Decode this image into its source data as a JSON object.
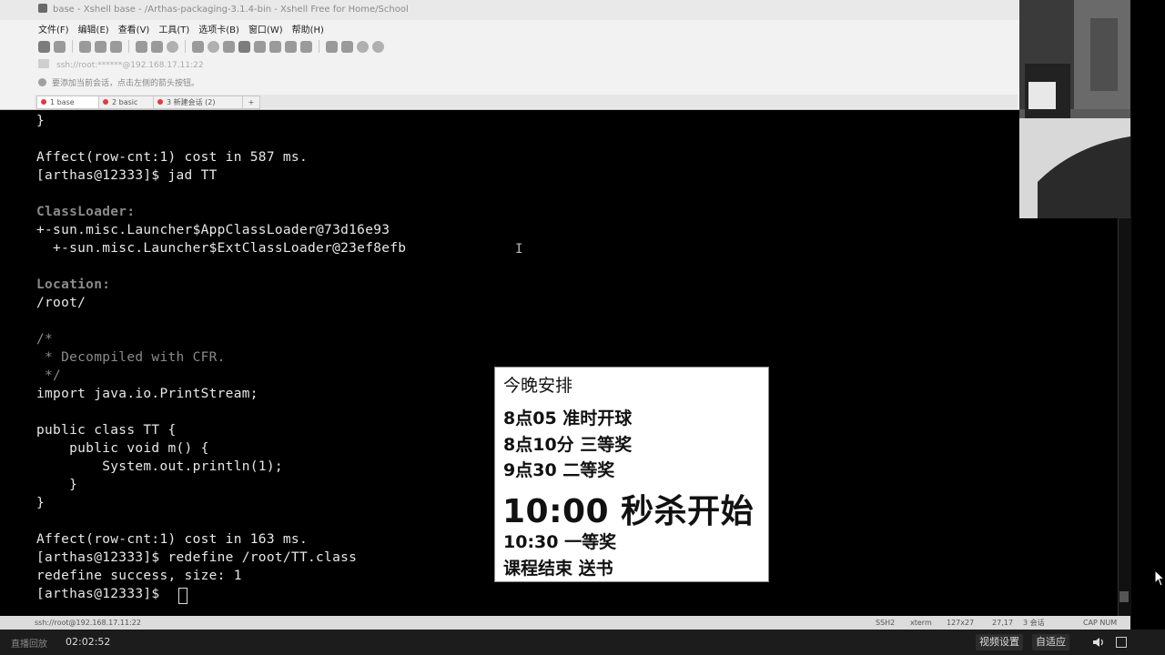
{
  "window": {
    "title": "base - Xshell base - /Arthas-packaging-3.1.4-bin - Xshell Free for Home/School",
    "menu": [
      "文件(F)",
      "编辑(E)",
      "查看(V)",
      "工具(T)",
      "选项卡(B)",
      "窗口(W)",
      "帮助(H)"
    ],
    "address": "ssh://root:******@192.168.17.11:22",
    "tip": "要添加当前会话，点击左侧的箭头按钮。",
    "tabs": [
      "1 base",
      "2 basic",
      "3 新建会话 (2)"
    ],
    "tab_add": "+"
  },
  "terminal": {
    "lines": [
      {
        "text": "}",
        "style": "normal"
      },
      {
        "text": "",
        "style": "normal"
      },
      {
        "text": "Affect(row-cnt:1) cost in 587 ms.",
        "style": "normal"
      },
      {
        "text": "[arthas@12333]$ jad TT",
        "style": "normal"
      },
      {
        "text": "",
        "style": "normal"
      },
      {
        "text": "ClassLoader:",
        "style": "hdr"
      },
      {
        "text": "+-sun.misc.Launcher$AppClassLoader@73d16e93",
        "style": "normal"
      },
      {
        "text": "  +-sun.misc.Launcher$ExtClassLoader@23ef8efb",
        "style": "normal"
      },
      {
        "text": "",
        "style": "normal"
      },
      {
        "text": "Location:",
        "style": "hdr"
      },
      {
        "text": "/root/",
        "style": "normal"
      },
      {
        "text": "",
        "style": "normal"
      },
      {
        "text": "/*",
        "style": "cmt"
      },
      {
        "text": " * Decompiled with CFR.",
        "style": "cmt"
      },
      {
        "text": " */",
        "style": "cmt"
      },
      {
        "text": "import java.io.PrintStream;",
        "style": "normal"
      },
      {
        "text": "",
        "style": "normal"
      },
      {
        "text": "public class TT {",
        "style": "normal"
      },
      {
        "text": "    public void m() {",
        "style": "normal"
      },
      {
        "text": "        System.out.println(1);",
        "style": "normal"
      },
      {
        "text": "    }",
        "style": "normal"
      },
      {
        "text": "}",
        "style": "normal"
      },
      {
        "text": "",
        "style": "normal"
      },
      {
        "text": "Affect(row-cnt:1) cost in 163 ms.",
        "style": "normal"
      },
      {
        "text": "[arthas@12333]$ redefine /root/TT.class",
        "style": "normal"
      },
      {
        "text": "redefine success, size: 1",
        "style": "normal"
      },
      {
        "text": "[arthas@12333]$ ",
        "style": "normal"
      }
    ],
    "ibeam": "I"
  },
  "statusbar": {
    "connection": "ssh://root@192.168.17.11:22",
    "protocol": "SSH2",
    "term": "xterm",
    "size": "127x27",
    "pos": "27,17",
    "sessions": "3 会话",
    "caps": "CAP NUM"
  },
  "card": {
    "title": "今晚安排",
    "items": [
      "8点05 准时开球",
      "8点10分 三等奖",
      "9点30 二等奖"
    ],
    "highlight": "10:00 秒杀开始",
    "items2": [
      "10:30 一等奖",
      "课程结束 送书"
    ]
  },
  "player": {
    "live_label": "直播回放",
    "time": "02:02:52",
    "settings_button": "视频设置",
    "adapt_button": "自适应"
  },
  "icons": {
    "window": "xshell-app-icon",
    "volume": "volume-icon",
    "fullscreen": "fullscreen-icon"
  }
}
